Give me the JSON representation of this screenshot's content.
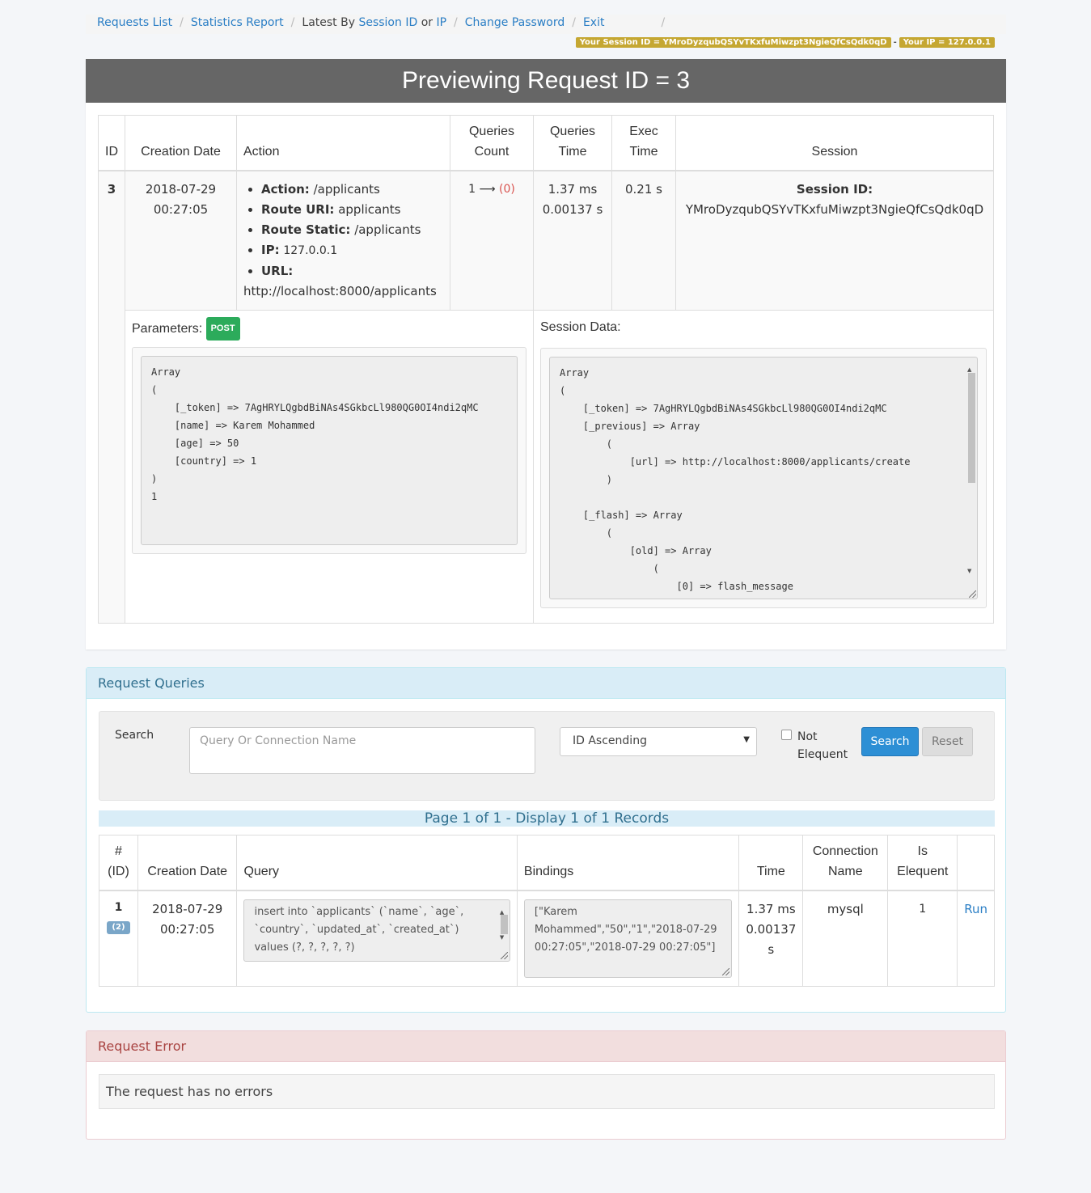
{
  "nav": {
    "requests_list": "Requests List",
    "statistics_report": "Statistics Report",
    "latest_by": "Latest By",
    "session_id": "Session ID",
    "or": "or",
    "ip": "IP",
    "change_password": "Change Password",
    "exit": "Exit",
    "sep": "/"
  },
  "badges": {
    "session": "Your Session ID = YMroDyzqubQSYvTKxfuMiwzpt3NgieQfCsQdk0qD",
    "dash": "-",
    "ip": "Your IP = 127.0.0.1"
  },
  "preview": {
    "title": "Previewing Request ID = 3",
    "headers": {
      "id": "ID",
      "creation_date": "Creation Date",
      "action": "Action",
      "queries_count": "Queries Count",
      "queries_time": "Queries Time",
      "exec_time": "Exec Time",
      "session": "Session"
    },
    "row": {
      "id": "3",
      "date": "2018-07-29",
      "time": "00:27:05",
      "action_label": "Action:",
      "action_value": "/applicants",
      "route_uri_label": "Route URI:",
      "route_uri_value": "applicants",
      "route_static_label": "Route Static:",
      "route_static_value": "/applicants",
      "ip_label": "IP:",
      "ip_value": "127.0.0.1",
      "url_label": "URL:",
      "url_value": "http://localhost:8000/applicants",
      "queries_count": "1 ⟶",
      "queries_count_err": "(0)",
      "queries_time_ms": "1.37 ms",
      "queries_time_s": "0.00137 s",
      "exec_time": "0.21 s",
      "session_label": "Session ID:",
      "session_value": "YMroDyzqubQSYvTKxfuMiwzpt3NgieQfCsQdk0qD"
    },
    "parameters_label": "Parameters:",
    "method": "POST",
    "parameters_text": "Array\n(\n    [_token] => 7AgHRYLQgbdBiNAs4SGkbcLl980QG0OI4ndi2qMC\n    [name] => Karem Mohammed\n    [age] => 50\n    [country] => 1\n)\n1",
    "session_data_label": "Session Data:",
    "session_data_text": "Array\n(\n    [_token] => 7AgHRYLQgbdBiNAs4SGkbcLl980QG0OI4ndi2qMC\n    [_previous] => Array\n        (\n            [url] => http://localhost:8000/applicants/create\n        )\n\n    [_flash] => Array\n        (\n            [old] => Array\n                (\n                    [0] => flash_message\n                )"
  },
  "queries": {
    "panel_title": "Request Queries",
    "search_label": "Search",
    "search_placeholder": "Query Or Connection Name",
    "order_selected": "ID Ascending",
    "not_elequent": "Not Elequent",
    "search_button": "Search",
    "reset_button": "Reset",
    "page_info": "Page 1 of 1 - Display 1 of 1 Records",
    "headers": {
      "num_id": "# (ID)",
      "creation_date": "Creation Date",
      "query": "Query",
      "bindings": "Bindings",
      "time": "Time",
      "connection_name": "Connection Name",
      "is_elequent": "Is Elequent"
    },
    "rows": [
      {
        "num": "1",
        "id": "(2)",
        "date": "2018-07-29",
        "time": "00:27:05",
        "query": "insert into `applicants` (`name`, `age`, `country`, `updated_at`, `created_at`) values (?, ?, ?, ?, ?)",
        "bindings": "[\"Karem Mohammed\",\"50\",\"1\",\"2018-07-29 00:27:05\",\"2018-07-29 00:27:05\"]",
        "time_ms": "1.37 ms",
        "time_s": "0.00137 s",
        "connection": "mysql",
        "is_elequent": "1",
        "run": "Run"
      }
    ]
  },
  "error": {
    "panel_title": "Request Error",
    "message": "The request has no errors"
  }
}
